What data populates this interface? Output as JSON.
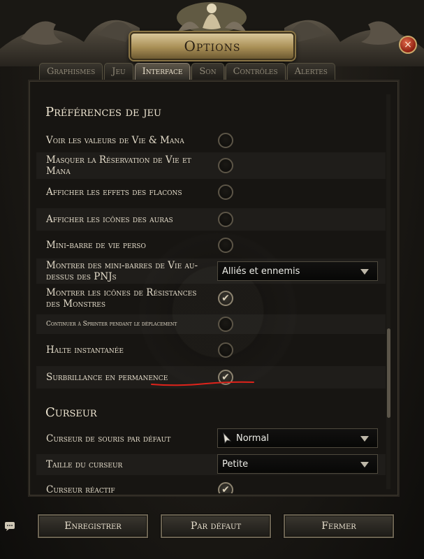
{
  "window": {
    "title": "Options",
    "close_label": "×"
  },
  "tabs": [
    {
      "label": "Graphismes",
      "active": false
    },
    {
      "label": "Jeu",
      "active": false
    },
    {
      "label": "Interface",
      "active": true
    },
    {
      "label": "Son",
      "active": false
    },
    {
      "label": "Contrôles",
      "active": false
    },
    {
      "label": "Alertes",
      "active": false
    }
  ],
  "sections": {
    "game_prefs": {
      "title": "Préférences de jeu",
      "rows": [
        {
          "label": "Voir les valeurs de Vie & Mana",
          "checked": false
        },
        {
          "label": "Masquer la Réservation de Vie et Mana",
          "checked": false
        },
        {
          "label": "Afficher les effets des flacons",
          "checked": false
        },
        {
          "label": "Afficher les icônes des auras",
          "checked": false
        },
        {
          "label": "Mini-barre de vie perso",
          "checked": false
        },
        {
          "label": "Montrer des mini-barres de Vie au-dessus des PNJs",
          "select_value": "Alliés et ennemis"
        },
        {
          "label": "Montrer les icônes de Résistances des Monstres",
          "checked": true
        },
        {
          "label": "Continuer à Sprinter pendant le déplacement",
          "checked": false
        },
        {
          "label": "Halte instantanée",
          "checked": false
        },
        {
          "label": "Surbrillance en permanence",
          "checked": true
        }
      ]
    },
    "cursor": {
      "title": "Curseur",
      "rows": [
        {
          "label": "Curseur de souris par défaut",
          "select_value": "Normal"
        },
        {
          "label": "Taille du curseur",
          "select_value": "Petite"
        },
        {
          "label": "Curseur réactif",
          "checked": true
        }
      ]
    }
  },
  "footer": {
    "save_label": "Enregistrer",
    "default_label": "Par défaut",
    "close_label": "Fermer"
  },
  "colors": {
    "accent_underline": "#e0231b",
    "title_plate": "#c8b27a",
    "close_button": "#b53a22"
  }
}
